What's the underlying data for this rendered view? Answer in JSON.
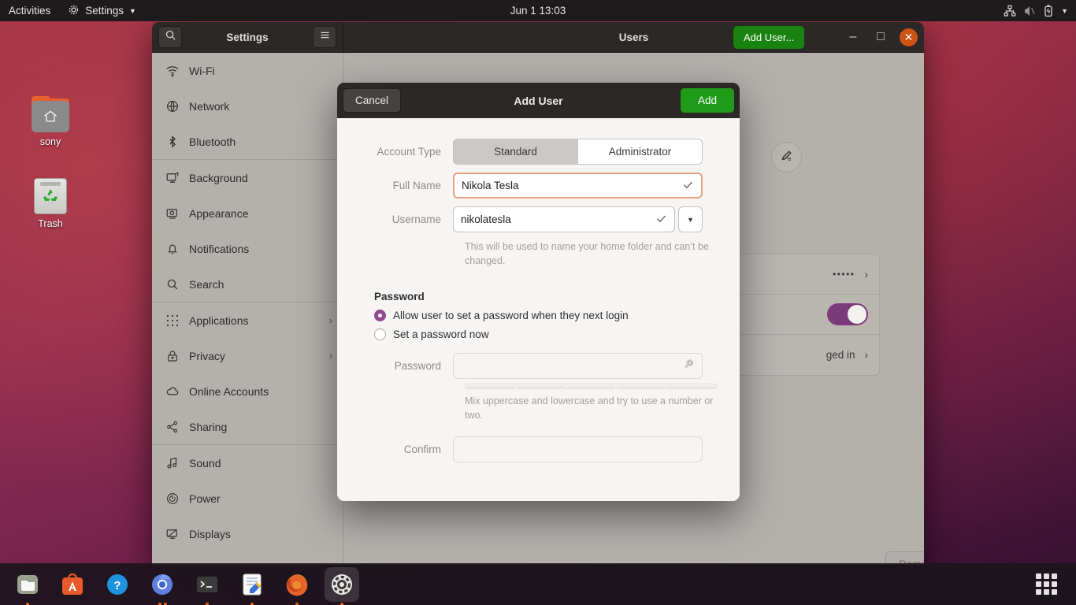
{
  "topbar": {
    "activities": "Activities",
    "app_menu": "Settings",
    "clock": "Jun 1  13:03",
    "icons": [
      "network-icon",
      "volume-muted-icon",
      "battery-icon",
      "chevron-down-icon"
    ]
  },
  "desktop": {
    "icons": [
      {
        "label": "sony",
        "type": "home-folder-icon"
      },
      {
        "label": "Trash",
        "type": "trash-icon"
      }
    ]
  },
  "window": {
    "sidebar_title": "Settings",
    "page_title": "Users",
    "add_user_button": "Add User...",
    "search_icon": "search-icon",
    "menu_icon": "hamburger-menu-icon",
    "minimize": "–",
    "maximize": "□",
    "close": "✕"
  },
  "sidebar": {
    "items": [
      {
        "label": "Wi-Fi",
        "icon": "wifi-icon",
        "chevron": ""
      },
      {
        "label": "Network",
        "icon": "network-globe-icon",
        "chevron": ""
      },
      {
        "label": "Bluetooth",
        "icon": "bluetooth-icon",
        "chevron": ""
      },
      {
        "label": "Background",
        "icon": "background-icon",
        "chevron": ""
      },
      {
        "label": "Appearance",
        "icon": "appearance-icon",
        "chevron": ""
      },
      {
        "label": "Notifications",
        "icon": "bell-icon",
        "chevron": ""
      },
      {
        "label": "Search",
        "icon": "search-icon",
        "chevron": ""
      },
      {
        "label": "Applications",
        "icon": "grid-dots-icon",
        "chevron": "›"
      },
      {
        "label": "Privacy",
        "icon": "lock-icon",
        "chevron": "›"
      },
      {
        "label": "Online Accounts",
        "icon": "cloud-icon",
        "chevron": ""
      },
      {
        "label": "Sharing",
        "icon": "share-icon",
        "chevron": ""
      },
      {
        "label": "Sound",
        "icon": "music-note-icon",
        "chevron": ""
      },
      {
        "label": "Power",
        "icon": "power-icon",
        "chevron": ""
      },
      {
        "label": "Displays",
        "icon": "display-icon",
        "chevron": ""
      }
    ]
  },
  "users_page": {
    "avatar_edit_icon": "pencil-edit-icon",
    "password_value": "•••••",
    "password_chevron": "›",
    "automatic_login_toggle": "on",
    "last_logged_in_value": "ged in",
    "last_logged_in_chevron": "›",
    "remove_user_button": "Remove User..."
  },
  "dialog": {
    "title": "Add User",
    "cancel_button": "Cancel",
    "add_button": "Add",
    "account_type_label": "Account Type",
    "account_type_options": [
      "Standard",
      "Administrator"
    ],
    "account_type_selected": "Standard",
    "full_name_label": "Full Name",
    "full_name_value": "Nikola Tesla",
    "full_name_valid_icon": "checkmark-icon",
    "username_label": "Username",
    "username_value": "nikolatesla",
    "username_valid_icon": "checkmark-icon",
    "username_dropdown_icon": "chevron-down-icon",
    "username_help": "This will be used to name your home folder and can’t be changed.",
    "password_section_title": "Password",
    "radio_allow_label": "Allow user to set a password when they next login",
    "radio_setnow_label": "Set a password now",
    "radio_selected": "allow",
    "password_label": "Password",
    "password_value": "",
    "password_generate_icon": "gear-generate-icon",
    "password_strength_segments": 5,
    "password_hint": "Mix uppercase and lowercase and try to use a number or two.",
    "confirm_label": "Confirm",
    "confirm_value": ""
  },
  "dock": {
    "items": [
      {
        "name": "files",
        "icon": "files-icon",
        "dots": 1,
        "active": false
      },
      {
        "name": "ubuntu-software",
        "icon": "ubuntu-software-icon",
        "dots": 0,
        "active": false
      },
      {
        "name": "help",
        "icon": "help-icon",
        "dots": 0,
        "active": false
      },
      {
        "name": "chromium",
        "icon": "chromium-icon",
        "dots": 2,
        "active": false
      },
      {
        "name": "terminal",
        "icon": "terminal-icon",
        "dots": 1,
        "active": false
      },
      {
        "name": "text-editor",
        "icon": "text-editor-icon",
        "dots": 1,
        "active": false
      },
      {
        "name": "firefox",
        "icon": "firefox-icon",
        "dots": 1,
        "active": false
      },
      {
        "name": "settings",
        "icon": "settings-gear-icon",
        "dots": 1,
        "active": true
      }
    ],
    "show_apps_icon": "show-applications-grid-icon"
  },
  "colors": {
    "accent_green": "#18830f",
    "close_orange": "#cd5312",
    "radio_purple": "#924a8f",
    "toggle_purple": "#7a3b78",
    "focus_border": "#e8a27f"
  }
}
